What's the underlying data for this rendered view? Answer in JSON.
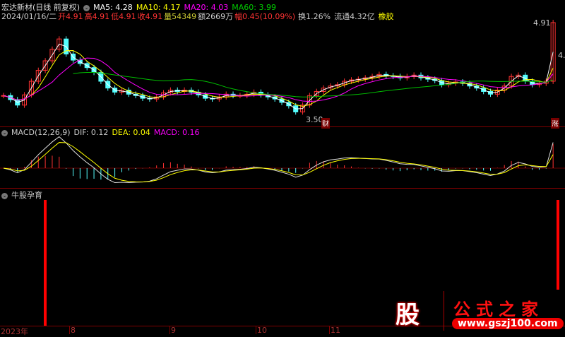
{
  "header": {
    "name": "宏达新材(日线 前复权)",
    "ma5": "MA5: 4.28",
    "ma10": "MA10: 4.17",
    "ma20": "MA20: 4.03",
    "ma60": "MA60: 3.99",
    "date": "2024/01/16/二",
    "open": "开4.91",
    "high": "高4.91",
    "low": "低4.91",
    "close": "收4.91",
    "vol": "量54349",
    "amt": "额2669万",
    "chg": "幅0.45(10.09%)",
    "turn": "换1.26%",
    "float": "流通4.32亿",
    "sector": "橡胶"
  },
  "labels": {
    "high_price": "4.91",
    "low_price": "3.50",
    "right_price": "4.",
    "cai": "财",
    "zhang": "涨"
  },
  "macd": {
    "title": "MACD(12,26,9)",
    "dif": "DIF: 0.12",
    "dea": "DEA: 0.04",
    "macd": "MACD: 0.16"
  },
  "indicator": {
    "title": "牛股孕育",
    "signals": [
      6,
      79
    ]
  },
  "axis": {
    "year": "2023年",
    "months": [
      "8",
      "9",
      "10",
      "11"
    ]
  },
  "watermark": {
    "logo": "股",
    "title": "公式之家",
    "url": "www.gszj100.com"
  },
  "colors": {
    "up": "#ff3232",
    "down": "#54ffff",
    "ma5": "#ffffff",
    "ma10": "#ffff00",
    "ma20": "#ff00ff",
    "ma60": "#00c000"
  },
  "chart_data": {
    "type": "candlestick",
    "price_range": [
      3.5,
      4.91
    ],
    "closes": [
      3.84,
      3.78,
      3.7,
      3.85,
      4.05,
      4.21,
      4.35,
      4.52,
      4.67,
      4.45,
      4.36,
      4.31,
      4.25,
      4.18,
      4.05,
      3.95,
      3.89,
      3.92,
      3.86,
      3.84,
      3.8,
      3.79,
      3.82,
      3.88,
      3.92,
      3.9,
      3.92,
      3.89,
      3.85,
      3.8,
      3.79,
      3.82,
      3.86,
      3.84,
      3.84,
      3.86,
      3.89,
      3.85,
      3.82,
      3.79,
      3.74,
      3.69,
      3.6,
      3.7,
      3.84,
      3.9,
      3.95,
      3.98,
      4.0,
      4.05,
      4.07,
      4.08,
      4.1,
      4.12,
      4.15,
      4.13,
      4.12,
      4.1,
      4.12,
      4.14,
      4.1,
      4.08,
      4.06,
      4.0,
      4.02,
      4.04,
      4.02,
      3.98,
      3.95,
      3.9,
      3.86,
      3.92,
      3.98,
      4.12,
      4.14,
      4.05,
      4.0,
      4.02,
      4.05,
      4.91
    ]
  }
}
